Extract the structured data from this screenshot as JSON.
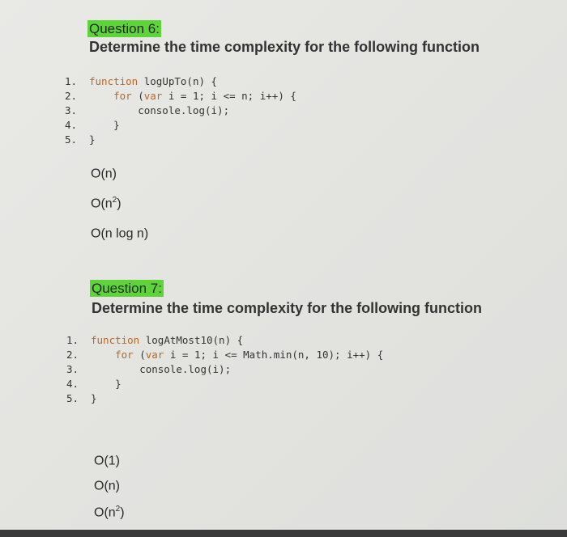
{
  "questions": [
    {
      "label": "Question 6:",
      "title": "Determine the time complexity for the following function",
      "code": [
        [
          {
            "t": "function",
            "k": 1
          },
          {
            "t": " logUpTo(n) {"
          }
        ],
        [
          {
            "t": "    "
          },
          {
            "t": "for",
            "k": 1
          },
          {
            "t": " ("
          },
          {
            "t": "var",
            "k": 1
          },
          {
            "t": " i = 1; i <= n; i++) {"
          }
        ],
        [
          {
            "t": "        console.log(i);"
          }
        ],
        [
          {
            "t": "    }"
          }
        ],
        [
          {
            "t": "}"
          }
        ]
      ],
      "options": [
        {
          "base": "O(n)",
          "sup": ""
        },
        {
          "base": "O(n",
          "sup": "2",
          "tail": ")"
        },
        {
          "base": "O(n log n)",
          "sup": ""
        }
      ]
    },
    {
      "label": "Question 7:",
      "title": "Determine the time complexity for the following function",
      "code": [
        [
          {
            "t": "function",
            "k": 1
          },
          {
            "t": " logAtMost10(n) {"
          }
        ],
        [
          {
            "t": "    "
          },
          {
            "t": "for",
            "k": 1
          },
          {
            "t": " ("
          },
          {
            "t": "var",
            "k": 1
          },
          {
            "t": " i = 1; i <= Math.min(n, 10); i++) {"
          }
        ],
        [
          {
            "t": "        console.log(i);"
          }
        ],
        [
          {
            "t": "    }"
          }
        ],
        [
          {
            "t": "}"
          }
        ]
      ],
      "options": [
        {
          "base": "O(1)",
          "sup": ""
        },
        {
          "base": "O(n)",
          "sup": ""
        },
        {
          "base": "O(n",
          "sup": "2",
          "tail": ")"
        }
      ]
    }
  ],
  "colors": {
    "highlight": "#5fd43a",
    "keyword": "#b5682a"
  }
}
